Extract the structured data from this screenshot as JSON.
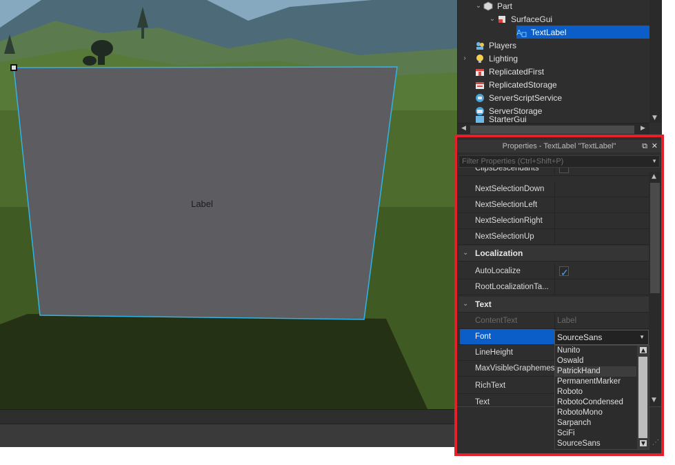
{
  "viewport": {
    "surface_label_text": "Label",
    "colors": {
      "panel": "#5d5c61",
      "panel_edge": "#2eb4e8"
    }
  },
  "explorer": {
    "items": [
      {
        "label": "Part",
        "icon": "part-icon",
        "expanded": true
      },
      {
        "label": "SurfaceGui",
        "icon": "surfacegui-icon",
        "expanded": true
      },
      {
        "label": "TextLabel",
        "icon": "textlabel-icon",
        "selected": true
      },
      {
        "label": "Players",
        "icon": "players-icon"
      },
      {
        "label": "Lighting",
        "icon": "lighting-icon",
        "collapsed": true
      },
      {
        "label": "ReplicatedFirst",
        "icon": "replicatedfirst-icon"
      },
      {
        "label": "ReplicatedStorage",
        "icon": "replicatedstorage-icon"
      },
      {
        "label": "ServerScriptService",
        "icon": "serverscriptservice-icon"
      },
      {
        "label": "ServerStorage",
        "icon": "serverstorage-icon"
      },
      {
        "label": "StarterGui",
        "icon": "startergui-icon"
      }
    ]
  },
  "properties": {
    "title": "Properties - TextLabel \"TextLabel\"",
    "filter_placeholder": "Filter Properties (Ctrl+Shift+P)",
    "rows": [
      {
        "name": "ClipsDescendants",
        "value": ""
      },
      {
        "name": "NextSelectionDown",
        "value": ""
      },
      {
        "name": "NextSelectionLeft",
        "value": ""
      },
      {
        "name": "NextSelectionRight",
        "value": ""
      },
      {
        "name": "NextSelectionUp",
        "value": ""
      },
      {
        "category": "Localization"
      },
      {
        "name": "AutoLocalize",
        "checked": true
      },
      {
        "name": "RootLocalizationTa...",
        "value": ""
      },
      {
        "category": "Text"
      },
      {
        "name": "ContentText",
        "value": "Label",
        "dim": true
      },
      {
        "name": "Font",
        "value": "SourceSans",
        "selected": true
      },
      {
        "name": "LineHeight",
        "value": ""
      },
      {
        "name": "MaxVisibleGraphemes",
        "value": ""
      },
      {
        "name": "RichText",
        "value": ""
      },
      {
        "name": "Text",
        "value": ""
      }
    ],
    "font_dropdown": {
      "selected": "SourceSans",
      "options": [
        "Nunito",
        "Oswald",
        "PatrickHand",
        "PermanentMarker",
        "Roboto",
        "RobotoCondensed",
        "RobotoMono",
        "Sarpanch",
        "SciFi",
        "SourceSans"
      ],
      "hovered": "PatrickHand"
    }
  },
  "accent_colors": {
    "selection": "#0b5dc7",
    "highlight_border": "#e5202b"
  }
}
